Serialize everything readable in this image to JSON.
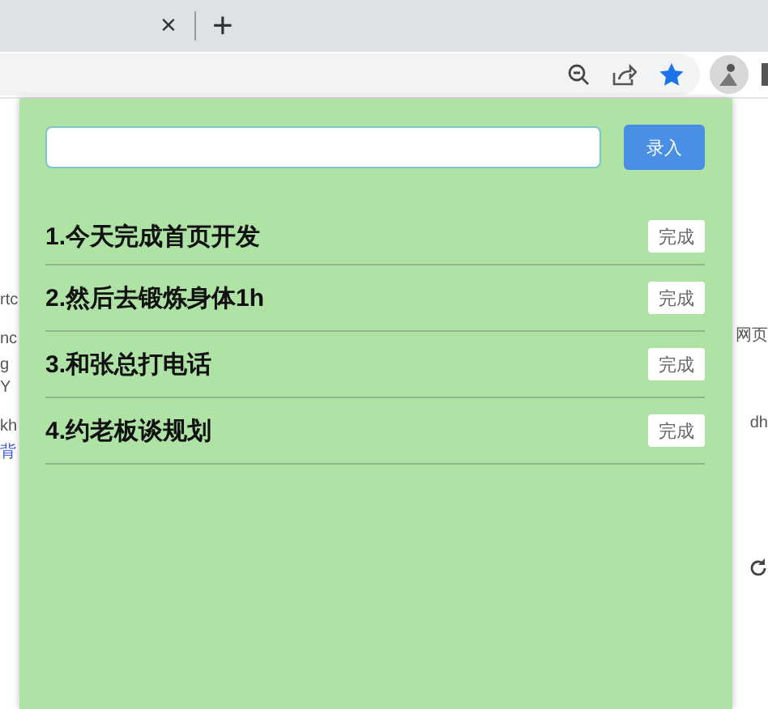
{
  "browser": {
    "tab_close": "×",
    "new_tab": "+"
  },
  "background_page": {
    "left_groups": [
      [
        {
          "text": "rtc",
          "kind": "text"
        }
      ],
      [
        {
          "text": "nc",
          "kind": "text"
        },
        {
          "text": "g Y",
          "kind": "text"
        }
      ],
      [
        {
          "text": "kh",
          "kind": "text"
        },
        {
          "text": "背",
          "kind": "link"
        }
      ]
    ],
    "right_groups": [
      [
        {
          "text": "网页",
          "kind": "text"
        }
      ],
      [
        {
          "text": "dh",
          "kind": "text"
        }
      ]
    ]
  },
  "popup": {
    "submit_button": "录入",
    "todos": [
      {
        "text": "1.今天完成首页开发",
        "button": "完成"
      },
      {
        "text": "2.然后去锻炼身体1h",
        "button": "完成"
      },
      {
        "text": "3.和张总打电话",
        "button": "完成"
      },
      {
        "text": "4.约老板谈规划",
        "button": "完成"
      }
    ]
  }
}
